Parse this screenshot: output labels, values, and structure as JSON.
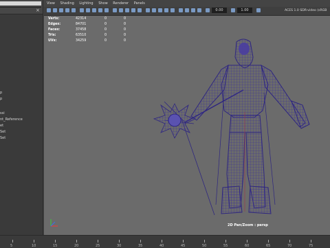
{
  "menubar": {
    "items": [
      "View",
      "Shading",
      "Lighting",
      "Show",
      "Renderer",
      "Panels"
    ]
  },
  "toolbar": {
    "exposure": "0.00",
    "gamma": "1.00",
    "colorspace": "ACES 1.0 SDR-video (sRGB"
  },
  "outliner": {
    "items": [
      "p",
      "p",
      "ssi",
      "nt_Reference",
      "et",
      "Set",
      "Set"
    ]
  },
  "hud": {
    "rows": [
      {
        "label": "Verts:",
        "v1": "42314",
        "v2": "0",
        "v3": "0"
      },
      {
        "label": "Edges:",
        "v1": "84701",
        "v2": "0",
        "v3": "0"
      },
      {
        "label": "Faces:",
        "v1": "37458",
        "v2": "0",
        "v3": "0"
      },
      {
        "label": "Tris:",
        "v1": "63510",
        "v2": "0",
        "v3": "0"
      },
      {
        "label": "UVs:",
        "v1": "34259",
        "v2": "0",
        "v3": "0"
      }
    ]
  },
  "camera": {
    "label": "2D Pan/Zoom : persp"
  },
  "timeline": {
    "ticks": [
      "5",
      "10",
      "15",
      "20",
      "25",
      "30",
      "35",
      "40",
      "45",
      "50",
      "55",
      "60",
      "65",
      "70",
      "75"
    ]
  },
  "colors": {
    "viewport_bg": "#6b6b6b",
    "wireframe": "#3b2f9a",
    "ui_dark": "#3a3a3a"
  }
}
